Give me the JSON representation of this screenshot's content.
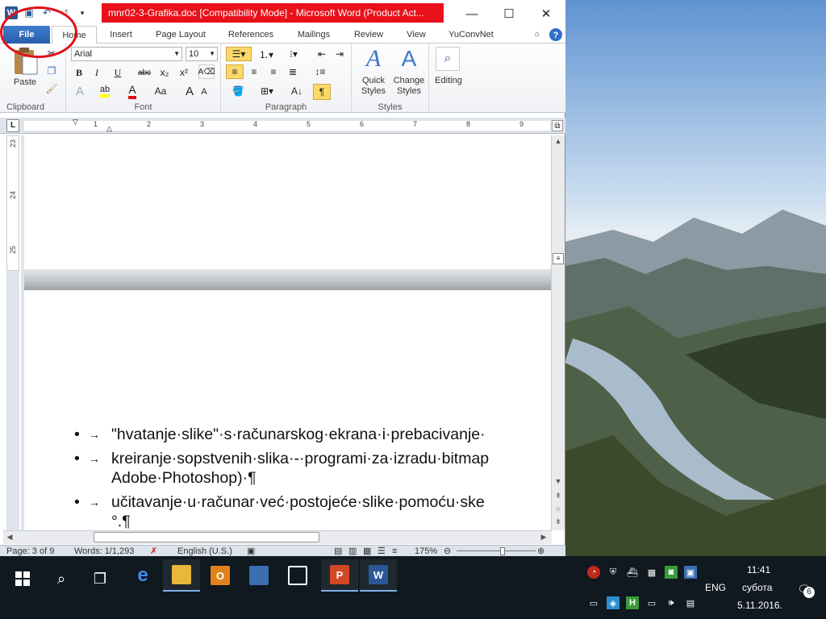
{
  "window": {
    "title": "mnr02-3-Grafika.doc [Compatibility Mode] - Microsoft Word (Product Act...",
    "minimize": "—",
    "maximize": "☐",
    "close": "✕"
  },
  "tabs": [
    "File",
    "Home",
    "Insert",
    "Page Layout",
    "References",
    "Mailings",
    "Review",
    "View",
    "YuConvNet"
  ],
  "ribbon": {
    "clipboard": {
      "label": "Clipboard",
      "paste": "Paste"
    },
    "font": {
      "label": "Font",
      "family": "Arial",
      "size": "10",
      "bold": "B",
      "italic": "I",
      "underline": "U",
      "strike": "abc",
      "subscript": "x₂",
      "superscript": "x²",
      "grow": "A",
      "shrink": "A",
      "case": "Aa"
    },
    "paragraph": {
      "label": "Paragraph",
      "pilcrow": "¶"
    },
    "styles": {
      "label": "Styles",
      "quick_styles": "Quick Styles",
      "change_styles": "Change Styles"
    },
    "editing": {
      "label": "Editing"
    }
  },
  "ruler": {
    "h_numbers": [
      "1",
      "2",
      "3",
      "4",
      "5",
      "6",
      "7",
      "8",
      "9"
    ],
    "v_numbers": [
      "23",
      "24",
      "25"
    ],
    "corner": "L"
  },
  "document": {
    "bullets": [
      "\"hvatanje·slike\"·s·računarskog·ekrana·i·prebacivanje·",
      "kreiranje·sopstvenih·slika·-·programi·za·izradu·bitmap",
      "učitavanje·u·računar·već·postojeće·slike·pomoću·ske"
    ],
    "continuation_1": "Adobe·Photoshop)·¶",
    "continuation_2": "°.¶"
  },
  "status": {
    "page": "Page: 3 of 9",
    "words": "Words: 1/1,293",
    "language": "English (U.S.)",
    "zoom": "175%"
  },
  "taskbar": {
    "apps": [
      {
        "name": "edge",
        "label": "e",
        "color": "#1e73d8"
      },
      {
        "name": "explorer",
        "label": "",
        "color": "#f0c040"
      },
      {
        "name": "outlook",
        "label": "O",
        "color": "#e0821c"
      },
      {
        "name": "network",
        "label": "",
        "color": "#3a6fb0"
      },
      {
        "name": "store",
        "label": "",
        "color": "#ffffff"
      },
      {
        "name": "powerpoint",
        "label": "P",
        "color": "#d24726"
      },
      {
        "name": "word",
        "label": "W",
        "color": "#2b5797"
      }
    ],
    "lang": "ENG",
    "time": "11:41",
    "day": "субота",
    "date": "5.11.2016.",
    "notifications": "6"
  }
}
